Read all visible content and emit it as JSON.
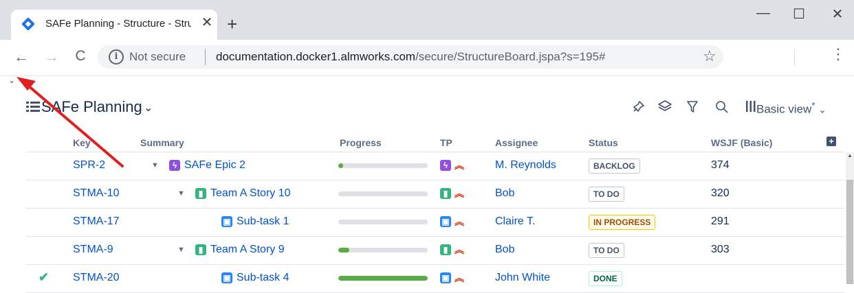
{
  "browser": {
    "tab_title": "SAFe Planning - Structure - Structu",
    "tab_close": "✕",
    "new_tab": "+",
    "window_controls": {
      "minimize": "—",
      "maximize": "☐",
      "close": "✕"
    },
    "nav": {
      "back": "←",
      "forward": "→",
      "reload": "C"
    },
    "security_label": "Not secure",
    "url_host": "documentation.docker1.almworks.com",
    "url_path": "/secure/StructureBoard.jspa?s=195#",
    "bookmark_icon": "☆",
    "menu_icon": "⋮"
  },
  "page": {
    "collapse_chevron": "⌄",
    "title": "SAFe Planning",
    "title_chevron": "⌄",
    "toolbar": {
      "pin": "pin-icon",
      "layers": "layers-icon",
      "filter": "filter-icon",
      "search": "search-icon"
    },
    "view_label": "Basic view",
    "view_modified": "*",
    "view_chevron": "⌄"
  },
  "columns": [
    "Key",
    "Summary",
    "Progress",
    "TP",
    "Assignee",
    "Status",
    "WSJF (Basic)"
  ],
  "add_column": "+",
  "rows": [
    {
      "check": "",
      "key": "SPR-2",
      "expander": "▼",
      "type": "epic",
      "type_glyph": "ϟ",
      "summary": "SAFe Epic 2",
      "progress": 0.05,
      "tp_type": "epic",
      "priority": "highest",
      "assignee": "M. Reynolds",
      "status": "BACKLOG",
      "wsjf": "374"
    },
    {
      "check": "",
      "key": "STMA-10",
      "expander": "▼",
      "type": "story",
      "type_glyph": "▮",
      "summary": "Team A Story 10",
      "progress": 0,
      "tp_type": "story",
      "priority": "highest",
      "assignee": "Bob",
      "status": "TO DO",
      "wsjf": "320"
    },
    {
      "check": "",
      "key": "STMA-17",
      "expander": "",
      "type": "subtask",
      "type_glyph": "▣",
      "summary": "Sub-task 1",
      "progress": 0,
      "tp_type": "subtask",
      "priority": "highest",
      "assignee": "Claire T.",
      "status": "IN PROGRESS",
      "wsjf": "291"
    },
    {
      "check": "",
      "key": "STMA-9",
      "expander": "▼",
      "type": "story",
      "type_glyph": "▮",
      "summary": "Team A Story 9",
      "progress": 0.12,
      "tp_type": "story",
      "priority": "highest",
      "assignee": "Bob",
      "status": "TO DO",
      "wsjf": "303"
    },
    {
      "check": "✔",
      "key": "STMA-20",
      "expander": "",
      "type": "subtask",
      "type_glyph": "▣",
      "summary": "Sub-task 4",
      "progress": 1.0,
      "tp_type": "subtask",
      "priority": "highest",
      "assignee": "John White",
      "status": "DONE",
      "wsjf": ""
    }
  ],
  "priority_glyph": "≈"
}
